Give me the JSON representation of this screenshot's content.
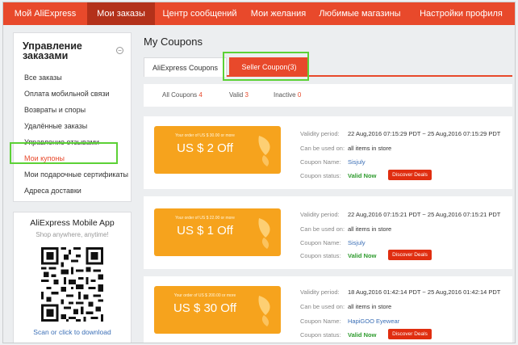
{
  "topnav": {
    "items": [
      {
        "label": "Мой AliExpress"
      },
      {
        "label": "Мои заказы"
      },
      {
        "label": "Центр сообщений"
      },
      {
        "label": "Мои желания"
      },
      {
        "label": "Любимые магазины"
      },
      {
        "label": "Настройки профиля"
      }
    ],
    "active_index": 1
  },
  "sidebar": {
    "title": "Управление заказами",
    "collapse_icon": "minus-circle-icon",
    "items": [
      {
        "label": "Все заказы"
      },
      {
        "label": "Оплата мобильной связи"
      },
      {
        "label": "Возвраты и споры"
      },
      {
        "label": "Удалённые заказы"
      },
      {
        "label": "Управление отзывами"
      },
      {
        "label": "Мои купоны"
      },
      {
        "label": "Мои подарочные сертификаты"
      },
      {
        "label": "Адреса доставки"
      }
    ],
    "active_index": 5
  },
  "app_panel": {
    "title": "AliExpress Mobile App",
    "subtitle": "Shop anywhere, anytime!",
    "scan_text": "Scan or click to download"
  },
  "main": {
    "title": "My Coupons",
    "tabs": [
      {
        "label": "AliExpress Coupons"
      },
      {
        "label": "Seller Coupon(3)"
      }
    ],
    "filters": [
      {
        "label": "All Coupons",
        "count": "4"
      },
      {
        "label": "Valid",
        "count": "3"
      },
      {
        "label": "Inactive",
        "count": "0"
      }
    ],
    "labels": {
      "validity": "Validity period:",
      "used_on": "Can be used on:",
      "name": "Coupon Name:",
      "status": "Coupon status:",
      "button": "Discover Deals"
    },
    "coupons": [
      {
        "small": "Your order of US $ 30.00 or more",
        "value": "US $ 2 Off",
        "validity": "22 Aug,2016 07:15:29 PDT ~ 25 Aug,2016 07:15:29 PDT",
        "used_on": "all items in store",
        "name": "Sisjuly",
        "status": "Valid Now"
      },
      {
        "small": "Your order of US $ 22.00 or more",
        "value": "US $ 1 Off",
        "validity": "22 Aug,2016 07:15:21 PDT ~ 25 Aug,2016 07:15:21 PDT",
        "used_on": "all items in store",
        "name": "Sisjuly",
        "status": "Valid Now"
      },
      {
        "small": "Your order of US $ 200.00 or more",
        "value": "US $ 30 Off",
        "validity": "18 Aug,2016 01:42:14 PDT ~ 25 Aug,2016 01:42:14 PDT",
        "used_on": "all items in store",
        "name": "HapiGOO Eyewear",
        "status": "Valid Now"
      }
    ]
  },
  "colors": {
    "accent": "#e8492b",
    "nav_active": "#b3311a",
    "coupon": "#f6a31d",
    "valid": "#2e9b2e",
    "highlight": "#5cd136"
  }
}
